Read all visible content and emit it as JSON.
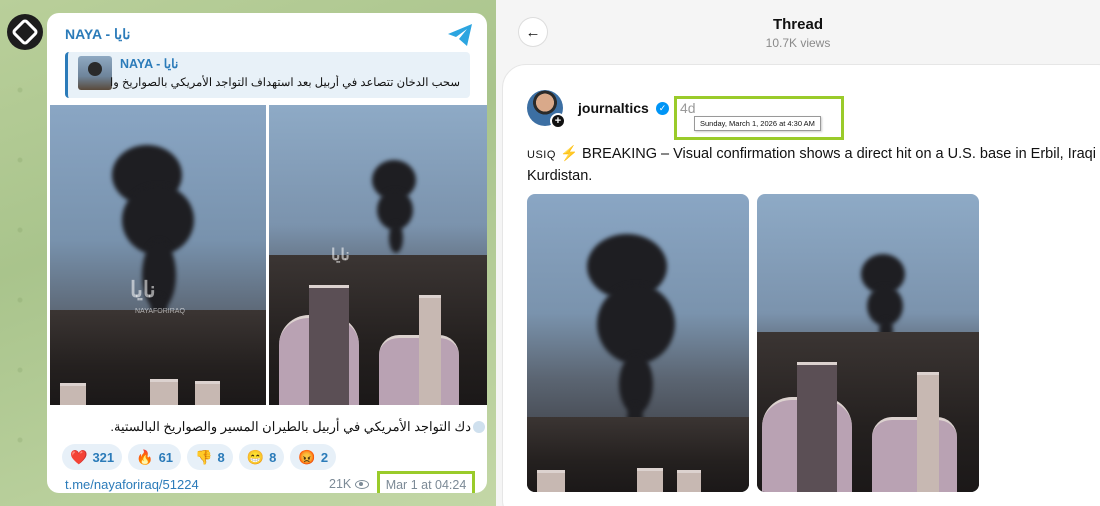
{
  "telegram": {
    "channel_name": "NAYA - نايا",
    "reply": {
      "name": "NAYA - نايا",
      "text": "سحب الدخان تتصاعد في أربيل بعد استهداف التواجد الأمريكي بالصواريخ والم..."
    },
    "photo_watermark": "نايا",
    "photo_watermark_sub": "NAYAFORIRAQ",
    "caption": "دك التواجد الأمريكي في أربيل بالطيران المسير والصواريخ البالستية.",
    "reactions": [
      {
        "emoji": "❤️",
        "icon": "heart-icon",
        "count": "321"
      },
      {
        "emoji": "🔥",
        "icon": "fire-icon",
        "count": "61"
      },
      {
        "emoji": "👎",
        "icon": "thumbs-down-icon",
        "count": "8"
      },
      {
        "emoji": "😁",
        "icon": "grin-icon",
        "count": "8"
      },
      {
        "emoji": "😡",
        "icon": "angry-icon",
        "count": "2"
      }
    ],
    "link": "t.me/nayaforiraq/51224",
    "views": "21K",
    "date": "Mar 1 at 04:24",
    "highlight_color": "#9acb2a",
    "accent_color": "#2b7bb9"
  },
  "threads": {
    "title": "Thread",
    "views": "10.7K views",
    "username": "journaltics",
    "time_ago": "4d",
    "tooltip": "Sunday, March 1, 2026 at 4:30 AM",
    "post": {
      "tag": "USIQ",
      "bolt": "⚡",
      "text": "BREAKING – Visual confirmation shows a direct hit on a U.S. base in Erbil, Iraqi Kurdistan."
    }
  }
}
